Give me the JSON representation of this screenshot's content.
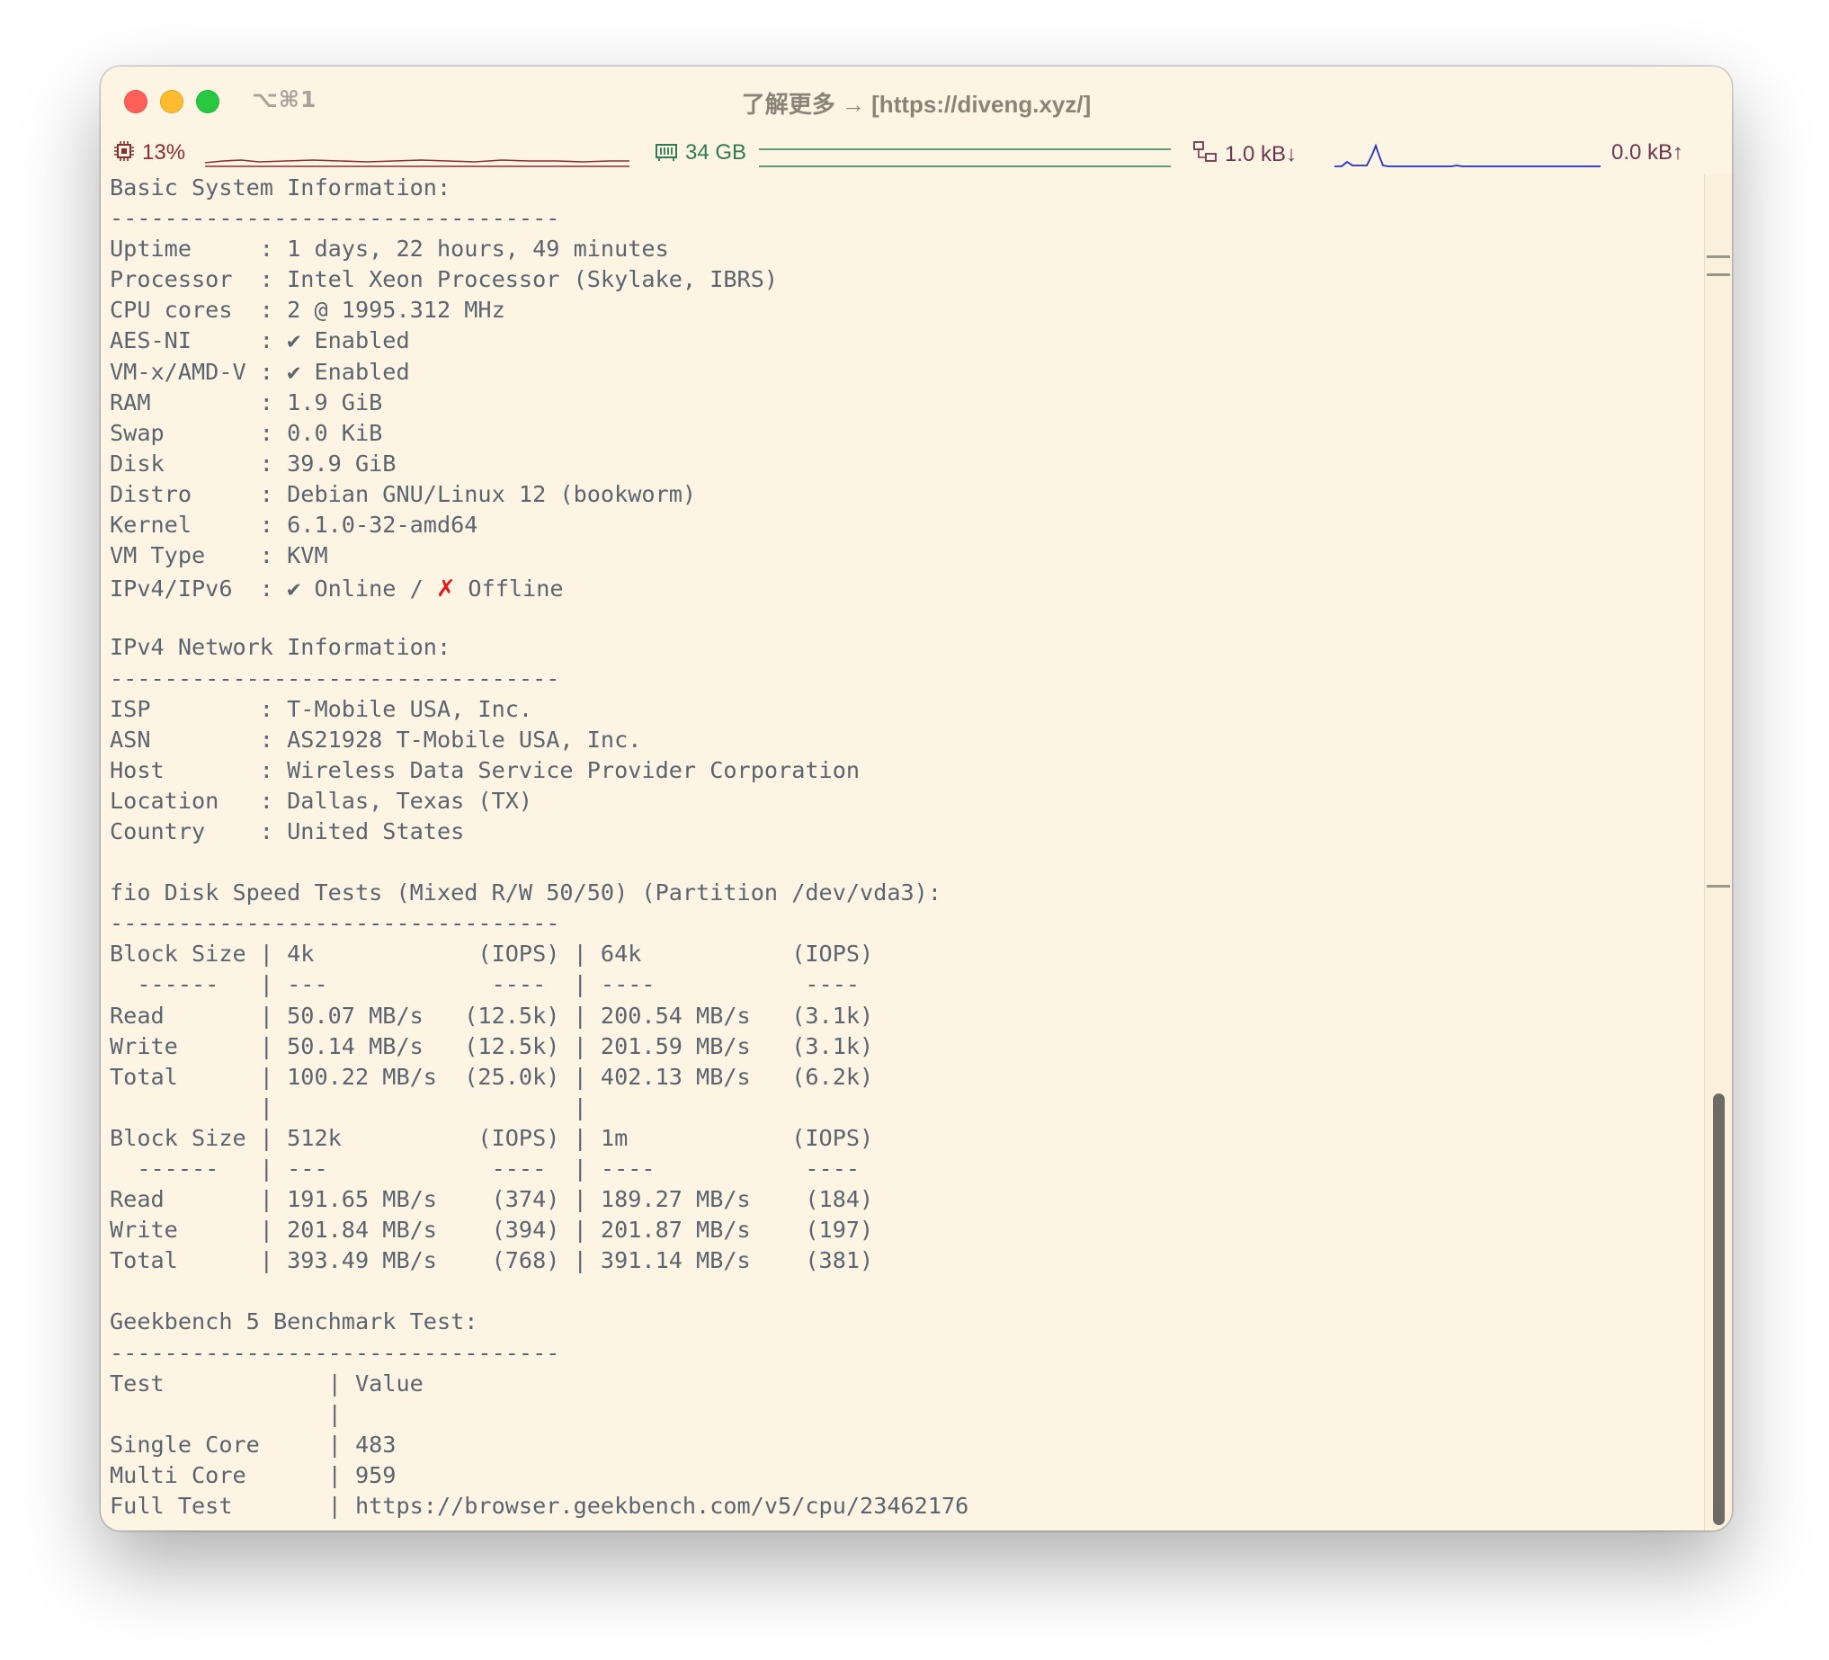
{
  "window": {
    "shortcut": "⌥⌘1",
    "title": "了解更多 → [https://diveng.xyz/]"
  },
  "status": {
    "cpu": "13%",
    "memory": "34 GB",
    "net_down": "1.0 kB↓",
    "net_up": "0.0 kB↑",
    "colors": {
      "cpu": "#8a2f2f",
      "memory": "#2f7a55",
      "network": "#1f2fc4"
    }
  },
  "terminal": {
    "lines": [
      "Basic System Information:",
      "---------------------------------",
      "Uptime     : 1 days, 22 hours, 49 minutes",
      "Processor  : Intel Xeon Processor (Skylake, IBRS)",
      "CPU cores  : 2 @ 1995.312 MHz",
      "AES-NI     : ✔ Enabled",
      "VM-x/AMD-V : ✔ Enabled",
      "RAM        : 1.9 GiB",
      "Swap       : 0.0 KiB",
      "Disk       : 39.9 GiB",
      "Distro     : Debian GNU/Linux 12 (bookworm)",
      "Kernel     : 6.1.0-32-amd64",
      "VM Type    : KVM",
      "IPv4/IPv6  : ✔ Online / ",
      "",
      "IPv4 Network Information:",
      "---------------------------------",
      "ISP        : T-Mobile USA, Inc.",
      "ASN        : AS21928 T-Mobile USA, Inc.",
      "Host       : Wireless Data Service Provider Corporation",
      "Location   : Dallas, Texas (TX)",
      "Country    : United States",
      "",
      "fio Disk Speed Tests (Mixed R/W 50/50) (Partition /dev/vda3):",
      "---------------------------------",
      "Block Size | 4k            (IOPS) | 64k           (IOPS)",
      "  ------   | ---            ----  | ----           ---- ",
      "Read       | 50.07 MB/s   (12.5k) | 200.54 MB/s   (3.1k)",
      "Write      | 50.14 MB/s   (12.5k) | 201.59 MB/s   (3.1k)",
      "Total      | 100.22 MB/s  (25.0k) | 402.13 MB/s   (6.2k)",
      "           |                      |",
      "Block Size | 512k          (IOPS) | 1m            (IOPS)",
      "  ------   | ---            ----  | ----           ---- ",
      "Read       | 191.65 MB/s    (374) | 189.27 MB/s    (184)",
      "Write      | 201.84 MB/s    (394) | 201.87 MB/s    (197)",
      "Total      | 393.49 MB/s    (768) | 391.14 MB/s    (381)",
      "",
      "Geekbench 5 Benchmark Test:",
      "---------------------------------",
      "Test            | Value",
      "                |",
      "Single Core     | 483",
      "Multi Core      | 959",
      "Full Test       | https://browser.geekbench.com/v5/cpu/23462176"
    ],
    "ipv6_status": " Offline"
  }
}
